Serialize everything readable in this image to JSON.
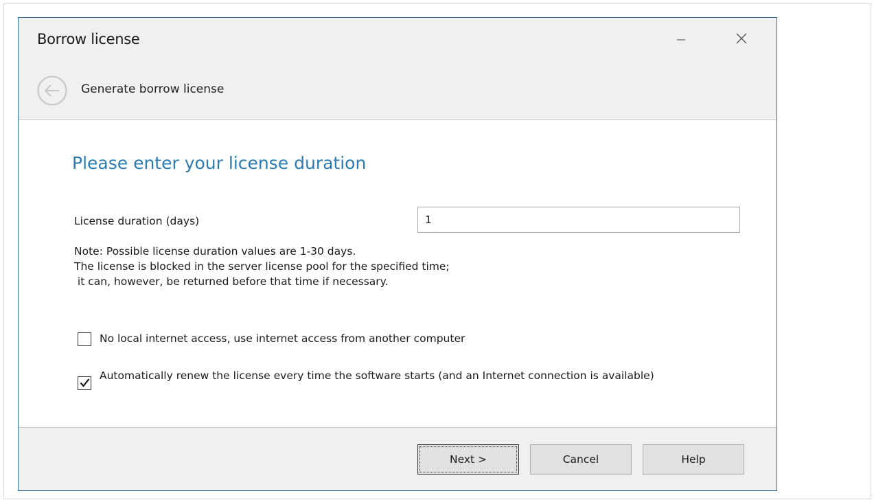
{
  "window": {
    "title": "Borrow license"
  },
  "nav": {
    "title": "Generate borrow license"
  },
  "content": {
    "heading": "Please enter your license duration",
    "duration_label": "License duration (days)",
    "duration_value": "1",
    "note_lines": [
      "Note: Possible license duration values are 1-30 days.",
      "The license is blocked in the server license pool for the specified time;",
      " it can, however, be returned before that time if necessary."
    ],
    "options": [
      {
        "label": "No local internet access, use internet access from another computer",
        "checked": false
      },
      {
        "label": "Automatically renew the license every time the software starts (and an Internet connection is available)",
        "checked": true
      }
    ]
  },
  "footer": {
    "next_label": "Next >",
    "cancel_label": "Cancel",
    "help_label": "Help"
  },
  "colors": {
    "accent": "#2b7cb3",
    "window_border": "#2e6da4",
    "chrome_bg": "#f0f0f0"
  },
  "icons": {
    "back": "back-arrow-circle-icon",
    "minimize": "minimize-icon",
    "close": "close-icon",
    "check": "checkmark-icon"
  }
}
